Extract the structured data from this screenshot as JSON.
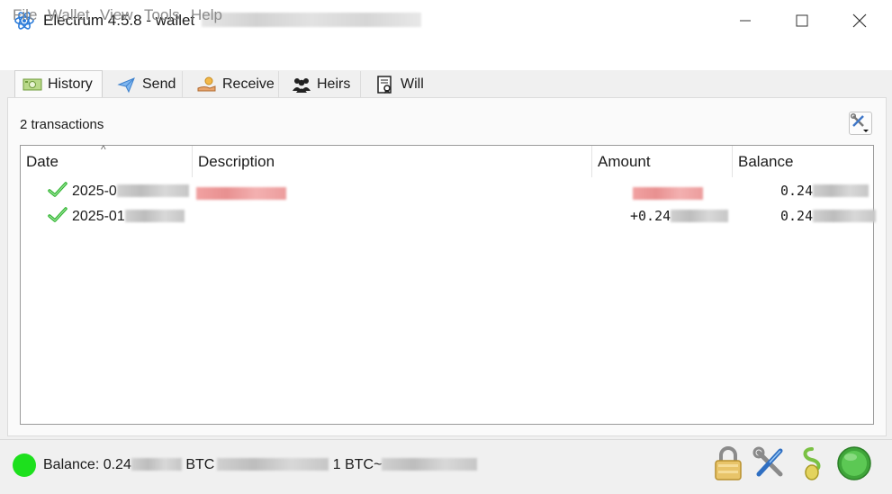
{
  "window": {
    "app_title": "Electrum 4.5.8  -  wallet",
    "colors": {
      "accent_blue": "#2b7bd9",
      "ok_green": "#2fb52f",
      "negative_red": "#e05555",
      "status_green": "#1de01d"
    }
  },
  "menu": [
    "File",
    "Wallet",
    "View",
    "Tools",
    "Help"
  ],
  "tabs": [
    {
      "label": "History",
      "icon": "history-icon"
    },
    {
      "label": "Send",
      "icon": "send-icon"
    },
    {
      "label": "Receive",
      "icon": "receive-icon"
    },
    {
      "label": "Heirs",
      "icon": "heirs-icon"
    },
    {
      "label": "Will",
      "icon": "will-icon"
    }
  ],
  "history": {
    "count_text": "2 transactions",
    "columns": [
      "Date",
      "Description",
      "Amount",
      "Balance"
    ],
    "rows": [
      {
        "date": "2025-0",
        "description": "",
        "amount": "",
        "balance": "0.24",
        "status_icon": "confirmed-check-icon"
      },
      {
        "date": "2025-01",
        "description": "",
        "amount": "+0.24",
        "balance": "0.24",
        "status_icon": "confirmed-check-icon"
      }
    ]
  },
  "status": {
    "balance_label": "Balance: 0.24",
    "btc_unit": "BTC",
    "rate_prefix": "1 BTC~",
    "icons": [
      "lock-icon",
      "preferences-icon",
      "seed-icon",
      "network-status-icon"
    ]
  }
}
